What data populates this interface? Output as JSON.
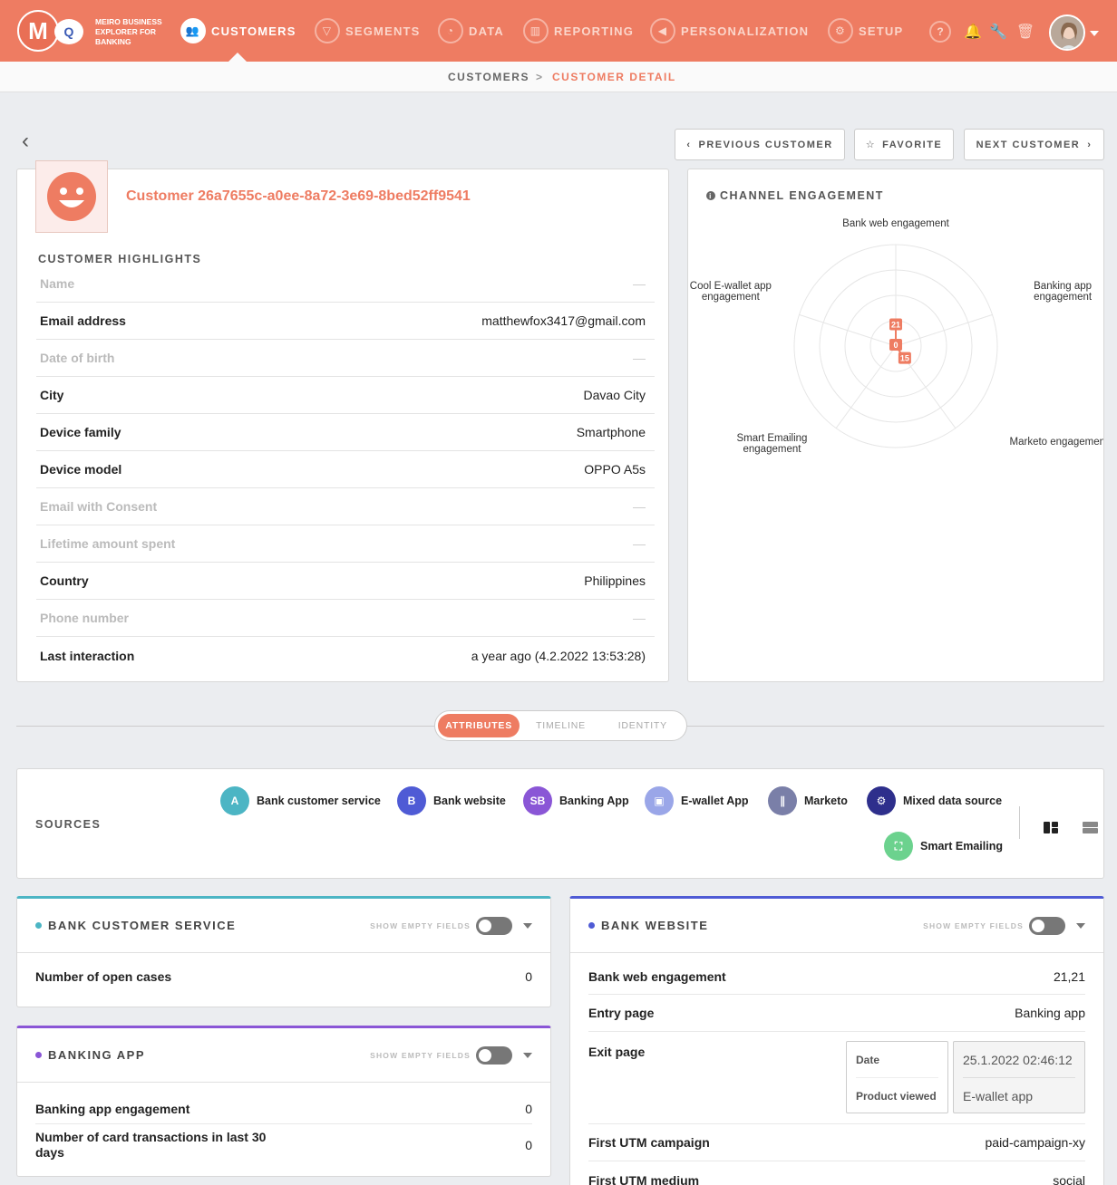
{
  "brand": {
    "text_line1": "MEIRO BUSINESS",
    "text_line2": "EXPLORER FOR",
    "text_line3": "BANKING"
  },
  "nav": {
    "customers": "CUSTOMERS",
    "segments": "SEGMENTS",
    "data": "DATA",
    "reporting": "REPORTING",
    "personalization": "PERSONALIZATION",
    "setup": "SETUP",
    "help": "?"
  },
  "breadcrumb": {
    "root": "CUSTOMERS",
    "separator": ">",
    "current": "CUSTOMER DETAIL"
  },
  "actions": {
    "previous": "PREVIOUS CUSTOMER",
    "favorite": "FAVORITE",
    "next": "NEXT CUSTOMER"
  },
  "customer": {
    "name": "Customer 26a7655c-a0ee-8a72-3e69-8bed52ff9541"
  },
  "highlights": {
    "title": "CUSTOMER HIGHLIGHTS",
    "rows": [
      {
        "label": "Name",
        "value": "—",
        "empty": true
      },
      {
        "label": "Email address",
        "value": "matthewfox3417@gmail.com",
        "empty": false
      },
      {
        "label": "Date of birth",
        "value": "—",
        "empty": true
      },
      {
        "label": "City",
        "value": "Davao City",
        "empty": false
      },
      {
        "label": "Device family",
        "value": "Smartphone",
        "empty": false
      },
      {
        "label": "Device model",
        "value": "OPPO A5s",
        "empty": false
      },
      {
        "label": "Email with Consent",
        "value": "—",
        "empty": true
      },
      {
        "label": "Lifetime amount spent",
        "value": "—",
        "empty": true
      },
      {
        "label": "Country",
        "value": "Philippines",
        "empty": false
      },
      {
        "label": "Phone number",
        "value": "—",
        "empty": true
      },
      {
        "label": "Last interaction",
        "value": "a year ago (4.2.2022 13:53:28)",
        "empty": false
      }
    ]
  },
  "chart_data": {
    "type": "radar",
    "title": "CHANNEL ENGAGEMENT",
    "categories": [
      "Bank web engagement",
      "Banking app engagement",
      "Marketo engagement",
      "Smart Emailing engagement",
      "Cool E-wallet app engagement"
    ],
    "values": [
      21,
      0,
      15,
      0,
      0
    ],
    "point_labels": [
      "21",
      "0",
      "15"
    ],
    "max": 100,
    "color": "#ee7c62"
  },
  "tabs": {
    "attributes": "ATTRIBUTES",
    "timeline": "TIMELINE",
    "identity": "IDENTITY"
  },
  "sources": {
    "title": "SOURCES",
    "items": [
      {
        "name": "Bank customer service",
        "color": "#4cb5c4",
        "icon": "A"
      },
      {
        "name": "Bank website",
        "color": "#4f5bd5",
        "icon": "B"
      },
      {
        "name": "Banking App",
        "color": "#8a56d6",
        "icon": "SB"
      },
      {
        "name": "E-wallet App",
        "color": "#9aa6e8",
        "icon": "▣"
      },
      {
        "name": "Marketo",
        "color": "#7a7fa8",
        "icon": "∥"
      },
      {
        "name": "Mixed data source",
        "color": "#2e2f8c",
        "icon": "⚙"
      },
      {
        "name": "Smart Emailing",
        "color": "#6cd28e",
        "icon": "⛶"
      }
    ]
  },
  "show_empty_label": "SHOW EMPTY FIELDS",
  "panels": {
    "bcs": {
      "title": "BANK CUSTOMER SERVICE",
      "color": "#4cb5c4",
      "rows": [
        {
          "label": "Number of open cases",
          "value": "0"
        }
      ]
    },
    "bapp": {
      "title": "BANKING APP",
      "color": "#8a56d6",
      "rows": [
        {
          "label": "Banking app engagement",
          "value": "0"
        },
        {
          "label": "Number of card transactions in last 30 days",
          "value": "0"
        }
      ]
    },
    "bweb": {
      "title": "BANK WEBSITE",
      "color": "#4f5bd5",
      "rows": [
        {
          "label": "Bank web engagement",
          "value": "21,21"
        },
        {
          "label": "Entry page",
          "value": "Banking app"
        },
        {
          "label": "Exit page",
          "value": ""
        },
        {
          "label": "First UTM campaign",
          "value": "paid-campaign-xy"
        },
        {
          "label": "First UTM medium",
          "value": "social"
        }
      ],
      "exit_table": {
        "date_label": "Date",
        "date_value": "25.1.2022 02:46:12",
        "product_label": "Product viewed",
        "product_value": "E-wallet app"
      }
    }
  }
}
